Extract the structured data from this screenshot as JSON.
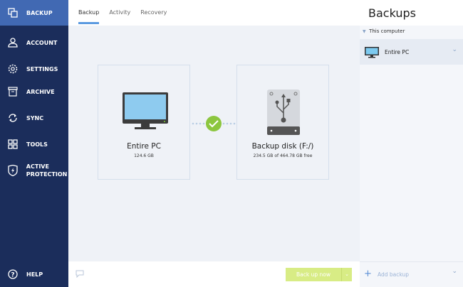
{
  "sidebar": {
    "items": [
      {
        "label": "BACKUP",
        "icon": "backup-icon"
      },
      {
        "label": "ACCOUNT",
        "icon": "user-icon"
      },
      {
        "label": "SETTINGS",
        "icon": "gear-icon"
      },
      {
        "label": "ARCHIVE",
        "icon": "archive-icon"
      },
      {
        "label": "SYNC",
        "icon": "sync-icon"
      },
      {
        "label": "TOOLS",
        "icon": "grid-icon"
      },
      {
        "label": "ACTIVE PROTECTION",
        "icon": "shield-icon"
      }
    ],
    "help": "HELP"
  },
  "tabs": [
    "Backup",
    "Activity",
    "Recovery"
  ],
  "source": {
    "title": "Entire PC",
    "subtitle": "124.6 GB"
  },
  "destination": {
    "title": "Backup disk (F:/)",
    "subtitle": "234.5 GB of 464.78 GB free"
  },
  "actions": {
    "backup_now": "Back up now"
  },
  "panel": {
    "title": "Backups",
    "group": "This computer",
    "item": "Entire PC",
    "add": "Add backup"
  },
  "colors": {
    "sidebar": "#1b2d5b",
    "active": "#4169b3",
    "success": "#8cc63f",
    "button": "#d8ec85"
  }
}
